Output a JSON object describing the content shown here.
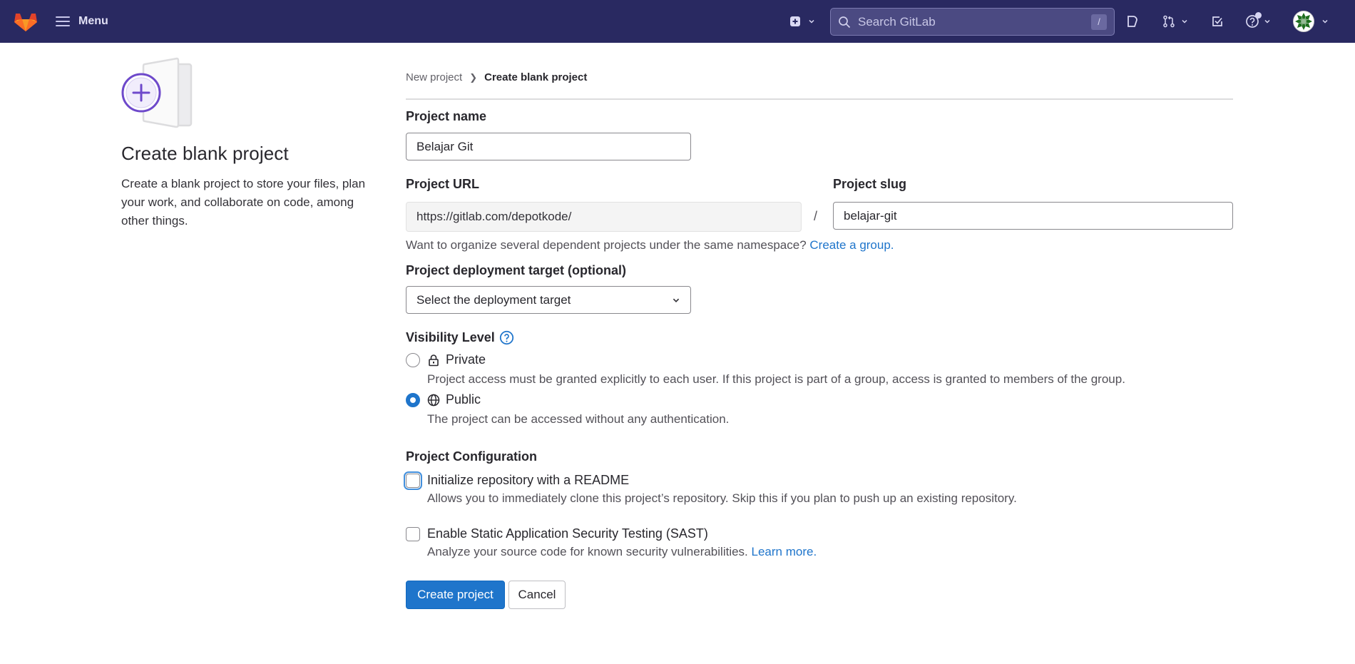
{
  "topbar": {
    "menu_label": "Menu",
    "search_placeholder": "Search GitLab",
    "search_shortcut": "/",
    "icons": [
      "gitlab-logo",
      "hamburger-icon",
      "create-new-icon",
      "chevron-down-icon",
      "search-icon",
      "issues-icon",
      "merge-requests-icon",
      "todos-icon",
      "help-icon",
      "user-avatar"
    ],
    "background_color": "#292961"
  },
  "sidebar": {
    "title": "Create blank project",
    "description": "Create a blank project to store your files, plan your work, and collaborate on code, among other things."
  },
  "breadcrumb": {
    "items": [
      {
        "label": "New project",
        "current": false
      },
      {
        "label": "Create blank project",
        "current": true
      }
    ]
  },
  "form": {
    "project_name": {
      "label": "Project name",
      "value": "Belajar Git"
    },
    "project_url": {
      "label": "Project URL",
      "value": "https://gitlab.com/depotkode/"
    },
    "url_separator": "/",
    "project_slug": {
      "label": "Project slug",
      "value": "belajar-git"
    },
    "namespace_help": {
      "text": "Want to organize several dependent projects under the same namespace?",
      "link": "Create a group."
    },
    "deployment_target": {
      "label": "Project deployment target (optional)",
      "selected": "Select the deployment target"
    },
    "visibility": {
      "label": "Visibility Level",
      "options": [
        {
          "label": "Private",
          "icon": "lock-icon",
          "description": "Project access must be granted explicitly to each user. If this project is part of a group, access is granted to members of the group.",
          "checked": false
        },
        {
          "label": "Public",
          "icon": "globe-icon",
          "description": "The project can be accessed without any authentication.",
          "checked": true
        }
      ]
    },
    "configuration": {
      "label": "Project Configuration",
      "options": [
        {
          "label": "Initialize repository with a README",
          "description": "Allows you to immediately clone this project’s repository. Skip this if you plan to push up an existing repository.",
          "checked": false
        },
        {
          "label": "Enable Static Application Security Testing (SAST)",
          "description": "Analyze your source code for known security vulnerabilities.",
          "link": "Learn more.",
          "checked": false
        }
      ]
    },
    "buttons": {
      "create": "Create project",
      "cancel": "Cancel"
    },
    "accent_color": "#1f75cb"
  }
}
